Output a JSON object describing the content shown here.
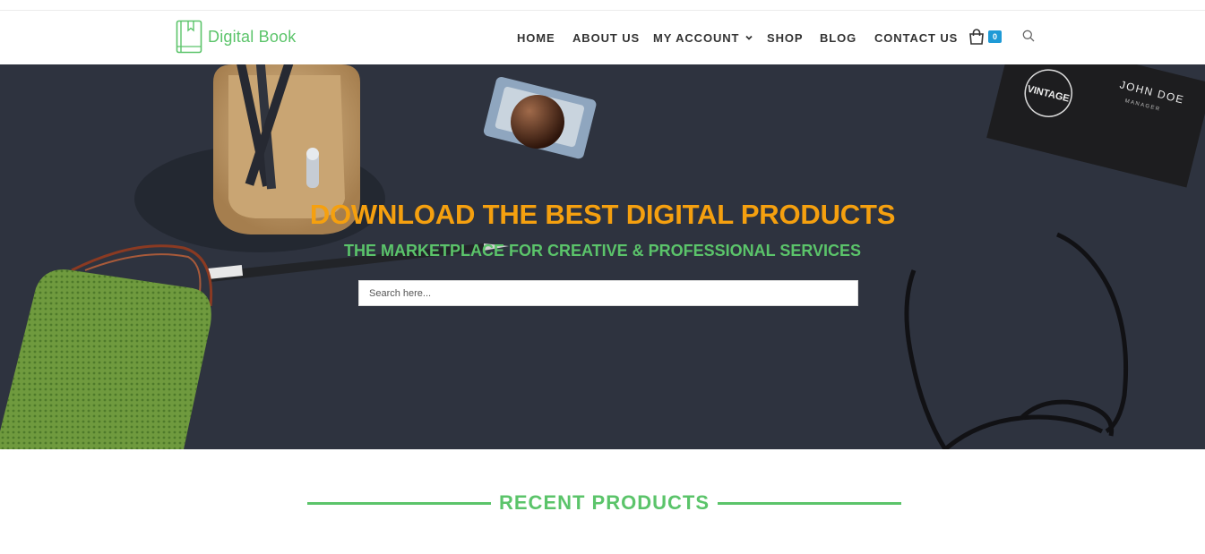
{
  "brand": {
    "name": "Digital Book",
    "color": "#5bc46a"
  },
  "nav": {
    "items": [
      {
        "label": "HOME"
      },
      {
        "label": "ABOUT US"
      },
      {
        "label": "MY ACCOUNT"
      },
      {
        "label": "SHOP"
      },
      {
        "label": "BLOG"
      },
      {
        "label": "CONTACT US"
      }
    ],
    "cart_count": "0",
    "cart_icon": "shopping-bag-icon",
    "search_icon": "search-icon",
    "dropdown_icon": "chevron-down-icon"
  },
  "hero": {
    "title": "DOWNLOAD THE BEST DIGITAL PRODUCTS",
    "subtitle": "THE MARKETPLACE FOR CREATIVE & PROFESSIONAL SERVICES",
    "search_placeholder": "Search here...",
    "title_color": "#f5a00f",
    "subtitle_color": "#5bc46a",
    "background_color": "#2e333f",
    "card_brand": "VINTAGE",
    "card_name": "JOHN DOE",
    "card_role": "MANAGER"
  },
  "recent": {
    "title": "RECENT PRODUCTS"
  }
}
